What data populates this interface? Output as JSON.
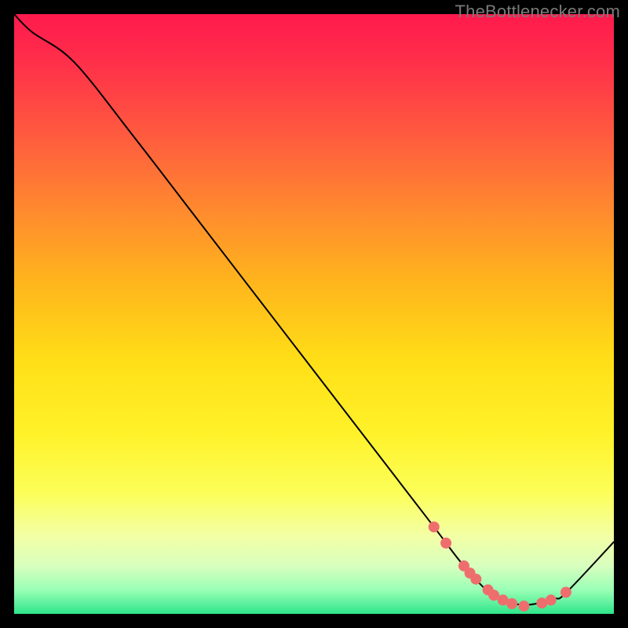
{
  "watermark": "TheBottleneсker.com",
  "chart_data": {
    "type": "line",
    "title": "",
    "xlabel": "",
    "ylabel": "",
    "xlim": [
      0,
      100
    ],
    "ylim": [
      0,
      100
    ],
    "x": [
      0,
      3,
      10,
      20,
      30,
      40,
      50,
      60,
      70,
      75,
      80,
      85,
      90,
      92,
      100
    ],
    "y": [
      100,
      97,
      92,
      79.5,
      66.5,
      53.5,
      40.5,
      27.5,
      14.5,
      8,
      3,
      1.5,
      2.5,
      3.5,
      12
    ],
    "markers": [
      {
        "x": 70,
        "y": 14.5
      },
      {
        "x": 72,
        "y": 11.8
      },
      {
        "x": 75,
        "y": 8.0
      },
      {
        "x": 76,
        "y": 6.8
      },
      {
        "x": 77,
        "y": 5.8
      },
      {
        "x": 79,
        "y": 4.0
      },
      {
        "x": 80,
        "y": 3.1
      },
      {
        "x": 81.5,
        "y": 2.3
      },
      {
        "x": 83,
        "y": 1.7
      },
      {
        "x": 85,
        "y": 1.3
      },
      {
        "x": 88,
        "y": 1.8
      },
      {
        "x": 89.5,
        "y": 2.3
      },
      {
        "x": 92,
        "y": 3.6
      }
    ],
    "marker_color": "#ee6e6e",
    "line_color": "#000000",
    "gradient_stops": [
      {
        "pos": 0.0,
        "color": "#ff1a4d"
      },
      {
        "pos": 0.08,
        "color": "#ff2f4a"
      },
      {
        "pos": 0.2,
        "color": "#ff5a3f"
      },
      {
        "pos": 0.33,
        "color": "#ff8b2e"
      },
      {
        "pos": 0.45,
        "color": "#ffb61c"
      },
      {
        "pos": 0.58,
        "color": "#ffdf17"
      },
      {
        "pos": 0.7,
        "color": "#fff22a"
      },
      {
        "pos": 0.8,
        "color": "#fcff5a"
      },
      {
        "pos": 0.87,
        "color": "#f3ffa6"
      },
      {
        "pos": 0.92,
        "color": "#d8ffbe"
      },
      {
        "pos": 0.96,
        "color": "#9affb6"
      },
      {
        "pos": 1.0,
        "color": "#2ee58a"
      }
    ]
  }
}
